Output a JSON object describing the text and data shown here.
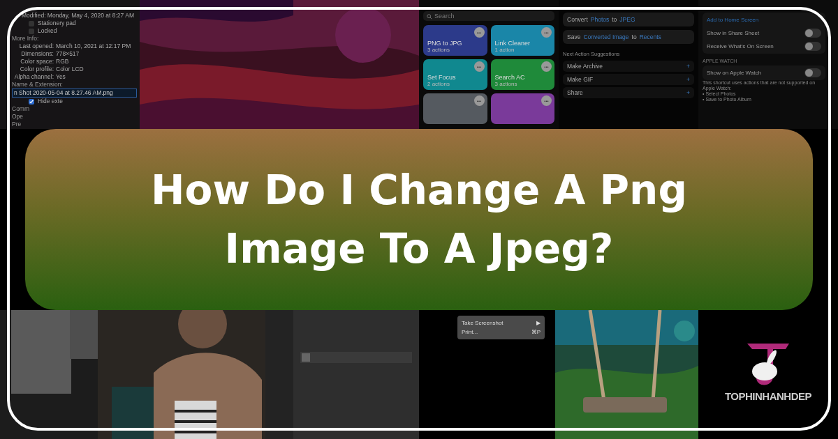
{
  "title": "How Do I Change A Png Image To A Jpeg?",
  "info_panel": {
    "modified": "Modified: Monday, May 4, 2020 at 8:27 AM",
    "checks": [
      {
        "label": "Stationery pad",
        "checked": false
      },
      {
        "label": "Locked",
        "checked": false
      }
    ],
    "more_info": "More Info:",
    "details": [
      {
        "key": "Last opened:",
        "value": "March 10, 2021 at 12:17 PM"
      },
      {
        "key": "Dimensions:",
        "value": "778×517"
      },
      {
        "key": "Color space:",
        "value": "RGB"
      },
      {
        "key": "Color profile:",
        "value": "Color LCD"
      },
      {
        "key": "Alpha channel:",
        "value": "Yes"
      }
    ],
    "name_section": "Name & Extension:",
    "filename": "n Shot 2020-05-04 at 8.27.46 AM.png",
    "hide_extension": {
      "label": "Hide exte",
      "checked": true
    },
    "sections": [
      "Comm",
      "Ope",
      "Pre"
    ]
  },
  "shortcuts": {
    "search": {
      "placeholder": "Search"
    },
    "tiles": [
      {
        "name": "PNG to JPG",
        "count": "3 actions",
        "color": "#2c3a8a",
        "more": "•••"
      },
      {
        "name": "Link Cleaner",
        "count": "1 action",
        "color": "#1a86a8",
        "more": "•••"
      },
      {
        "name": "Set Focus",
        "count": "2 actions",
        "color": "#10888f",
        "more": "•••"
      },
      {
        "name": "Search AC",
        "count": "3 actions",
        "color": "#1f8a3a",
        "more": "•••"
      },
      {
        "color": "#555a60",
        "more": "•••"
      },
      {
        "color": "#7a3a9a",
        "more": "•••"
      }
    ]
  },
  "actions": {
    "convert": {
      "verb": "Convert",
      "input": "Photos",
      "to": "to",
      "format": "JPEG"
    },
    "save": {
      "verb": "Save",
      "input": "Converted Image",
      "to": "to",
      "dest": "Recents"
    },
    "suggestions_title": "Next Action Suggestions",
    "suggestions": [
      {
        "label": "Make Archive",
        "add": "+"
      },
      {
        "label": "Make GIF",
        "add": "+"
      },
      {
        "label": "Share",
        "add": "+"
      }
    ]
  },
  "settings": {
    "rows": [
      {
        "label": "Add to Home Screen",
        "kind": "link"
      },
      {
        "label": "Show in Share Sheet",
        "kind": "toggle",
        "on": false
      },
      {
        "label": "Receive What's On Screen",
        "kind": "toggle",
        "on": false
      }
    ],
    "watch_header": "APPLE WATCH",
    "watch_row": {
      "label": "Show on Apple Watch",
      "on": false
    },
    "note": [
      "This shortcut uses actions that are not supported on Apple Watch:",
      "• Select Photos",
      "• Save to Photo Album"
    ]
  },
  "mac_menu": [
    {
      "label": "Take Screenshot",
      "hint": "▶"
    },
    {
      "label": "Print...",
      "hint": "⌘P"
    }
  ],
  "logo": {
    "text": "TOPHINHANHDEP"
  }
}
